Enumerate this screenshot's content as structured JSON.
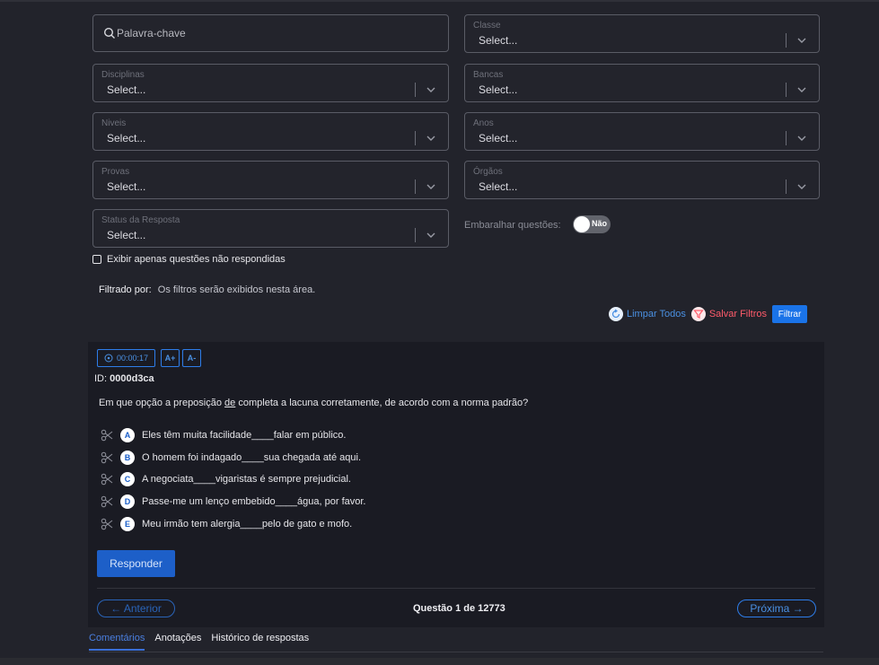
{
  "search": {
    "placeholder": "Palavra-chave"
  },
  "filters": {
    "classe": {
      "label": "Classe",
      "value": "Select..."
    },
    "disciplinas": {
      "label": "Disciplinas",
      "value": "Select..."
    },
    "bancas": {
      "label": "Bancas",
      "value": "Select..."
    },
    "niveis": {
      "label": "Niveis",
      "value": "Select..."
    },
    "anos": {
      "label": "Anos",
      "value": "Select..."
    },
    "provas": {
      "label": "Provas",
      "value": "Select..."
    },
    "orgaos": {
      "label": "Órgãos",
      "value": "Select..."
    },
    "status": {
      "label": "Status da Resposta",
      "value": "Select..."
    }
  },
  "shuffle": {
    "label": "Embaralhar questões:",
    "state": "Não"
  },
  "only_unanswered": {
    "label": "Exibir apenas questões não respondidas"
  },
  "filtered_by": {
    "label": "Filtrado por:",
    "text": "Os filtros serão exibidos nesta área."
  },
  "actions": {
    "clear": "Limpar Todos",
    "save": "Salvar Filtros",
    "filter": "Filtrar"
  },
  "question": {
    "timer": "00:00:17",
    "font_plus": "A+",
    "font_minus": "A-",
    "id_label": "ID:",
    "id": "0000d3ca",
    "statement_before": "Em que opção a preposição ",
    "statement_underlined": "de",
    "statement_after": " completa a lacuna corretamente, de acordo com a norma padrão?",
    "options": [
      {
        "letter": "A",
        "text": "Eles têm muita facilidade____falar em público."
      },
      {
        "letter": "B",
        "text": "O homem foi indagado____sua chegada até aqui."
      },
      {
        "letter": "C",
        "text": "A negociata____vigaristas é sempre prejudicial."
      },
      {
        "letter": "D",
        "text": "Passe-me um lenço embebido____água, por favor."
      },
      {
        "letter": "E",
        "text": "Meu irmão tem alergia____pelo de gato e mofo."
      }
    ],
    "answer_button": "Responder"
  },
  "navigation": {
    "previous": "← Anterior",
    "counter": "Questão 1 de 12773",
    "next": "Próxima →"
  },
  "tabs": [
    "Comentários",
    "Anotações",
    "Histórico de respostas"
  ],
  "colors": {
    "background": "#22232b",
    "card": "#1a1b23",
    "accent": "#1a73e8",
    "save": "#ff5b6a"
  }
}
